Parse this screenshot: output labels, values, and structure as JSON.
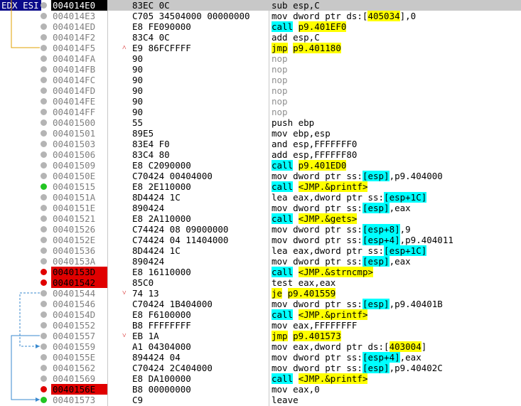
{
  "registers_label": "EDX ESI",
  "colors": {
    "breakpoint": "#e00000",
    "current": "#000000",
    "yellow": "#ffff00",
    "cyan": "#00ffff",
    "register_bg": "#0a0a8a"
  },
  "rows": [
    {
      "addr": "004014E0",
      "bytes": "83EC 0C",
      "parts": [
        [
          "sub esp,C",
          ""
        ]
      ],
      "kind": "current",
      "dot": "gray"
    },
    {
      "addr": "004014E3",
      "bytes": "C705 34504000 00000000",
      "parts": [
        [
          "mov dword ptr ds:[",
          ""
        ],
        [
          "405034",
          "y"
        ],
        [
          "],0",
          ""
        ]
      ],
      "kind": "",
      "dot": "gray"
    },
    {
      "addr": "004014ED",
      "bytes": "E8 FE090000",
      "parts": [
        [
          "call",
          "c"
        ],
        [
          " ",
          ""
        ],
        [
          "p9.401EF0",
          "y"
        ]
      ],
      "kind": "",
      "dot": "gray"
    },
    {
      "addr": "004014F2",
      "bytes": "83C4 0C",
      "parts": [
        [
          "add esp,C",
          ""
        ]
      ],
      "kind": "",
      "dot": "gray"
    },
    {
      "addr": "004014F5",
      "bytes": "E9 86FCFFFF",
      "parts": [
        [
          "jmp",
          "y"
        ],
        [
          " ",
          ""
        ],
        [
          "p9.401180",
          "y"
        ]
      ],
      "kind": "",
      "dot": "gray",
      "mark": "^"
    },
    {
      "addr": "004014FA",
      "bytes": "90",
      "parts": [
        [
          "nop",
          "n"
        ]
      ],
      "kind": "",
      "dot": "gray"
    },
    {
      "addr": "004014FB",
      "bytes": "90",
      "parts": [
        [
          "nop",
          "n"
        ]
      ],
      "kind": "",
      "dot": "gray"
    },
    {
      "addr": "004014FC",
      "bytes": "90",
      "parts": [
        [
          "nop",
          "n"
        ]
      ],
      "kind": "",
      "dot": "gray"
    },
    {
      "addr": "004014FD",
      "bytes": "90",
      "parts": [
        [
          "nop",
          "n"
        ]
      ],
      "kind": "",
      "dot": "gray"
    },
    {
      "addr": "004014FE",
      "bytes": "90",
      "parts": [
        [
          "nop",
          "n"
        ]
      ],
      "kind": "",
      "dot": "gray"
    },
    {
      "addr": "004014FF",
      "bytes": "90",
      "parts": [
        [
          "nop",
          "n"
        ]
      ],
      "kind": "",
      "dot": "gray"
    },
    {
      "addr": "00401500",
      "bytes": "55",
      "parts": [
        [
          "push ebp",
          ""
        ]
      ],
      "kind": "",
      "dot": "gray"
    },
    {
      "addr": "00401501",
      "bytes": "89E5",
      "parts": [
        [
          "mov ebp,esp",
          ""
        ]
      ],
      "kind": "",
      "dot": "gray"
    },
    {
      "addr": "00401503",
      "bytes": "83E4 F0",
      "parts": [
        [
          "and esp,FFFFFFF0",
          ""
        ]
      ],
      "kind": "",
      "dot": "gray"
    },
    {
      "addr": "00401506",
      "bytes": "83C4 80",
      "parts": [
        [
          "add esp,FFFFFF80",
          ""
        ]
      ],
      "kind": "",
      "dot": "gray"
    },
    {
      "addr": "00401509",
      "bytes": "E8 C2090000",
      "parts": [
        [
          "call",
          "c"
        ],
        [
          " ",
          ""
        ],
        [
          "p9.401ED0",
          "y"
        ]
      ],
      "kind": "",
      "dot": "gray"
    },
    {
      "addr": "0040150E",
      "bytes": "C70424 00404000",
      "parts": [
        [
          "mov dword ptr ss:",
          ""
        ],
        [
          "[esp]",
          "b"
        ],
        [
          ",p9.404000",
          ""
        ]
      ],
      "kind": "",
      "dot": "gray"
    },
    {
      "addr": "00401515",
      "bytes": "E8 2E110000",
      "parts": [
        [
          "call",
          "c"
        ],
        [
          " ",
          ""
        ],
        [
          "<JMP.&printf>",
          "y"
        ]
      ],
      "kind": "",
      "dot": "green"
    },
    {
      "addr": "0040151A",
      "bytes": "8D4424 1C",
      "parts": [
        [
          "lea eax,dword ptr ss:",
          ""
        ],
        [
          "[esp+1C]",
          "b"
        ]
      ],
      "kind": "",
      "dot": "gray"
    },
    {
      "addr": "0040151E",
      "bytes": "890424",
      "parts": [
        [
          "mov dword ptr ss:",
          ""
        ],
        [
          "[esp]",
          "b"
        ],
        [
          ",eax",
          ""
        ]
      ],
      "kind": "",
      "dot": "gray"
    },
    {
      "addr": "00401521",
      "bytes": "E8 2A110000",
      "parts": [
        [
          "call",
          "c"
        ],
        [
          " ",
          ""
        ],
        [
          "<JMP.&gets>",
          "y"
        ]
      ],
      "kind": "",
      "dot": "gray"
    },
    {
      "addr": "00401526",
      "bytes": "C74424 08 09000000",
      "parts": [
        [
          "mov dword ptr ss:",
          ""
        ],
        [
          "[esp+8]",
          "b"
        ],
        [
          ",9",
          ""
        ]
      ],
      "kind": "",
      "dot": "gray"
    },
    {
      "addr": "0040152E",
      "bytes": "C74424 04 11404000",
      "parts": [
        [
          "mov dword ptr ss:",
          ""
        ],
        [
          "[esp+4]",
          "b"
        ],
        [
          ",p9.404011",
          ""
        ]
      ],
      "kind": "",
      "dot": "gray"
    },
    {
      "addr": "00401536",
      "bytes": "8D4424 1C",
      "parts": [
        [
          "lea eax,dword ptr ss:",
          ""
        ],
        [
          "[esp+1C]",
          "b"
        ]
      ],
      "kind": "",
      "dot": "gray"
    },
    {
      "addr": "0040153A",
      "bytes": "890424",
      "parts": [
        [
          "mov dword ptr ss:",
          ""
        ],
        [
          "[esp]",
          "b"
        ],
        [
          ",eax",
          ""
        ]
      ],
      "kind": "",
      "dot": "gray"
    },
    {
      "addr": "0040153D",
      "bytes": "E8 16110000",
      "parts": [
        [
          "call",
          "c"
        ],
        [
          " ",
          ""
        ],
        [
          "<JMP.&strncmp>",
          "y"
        ]
      ],
      "kind": "bp",
      "dot": "red"
    },
    {
      "addr": "00401542",
      "bytes": "85C0",
      "parts": [
        [
          "test eax,eax",
          ""
        ]
      ],
      "kind": "bp",
      "dot": "red"
    },
    {
      "addr": "00401544",
      "bytes": "74 13",
      "parts": [
        [
          "je",
          "y"
        ],
        [
          " ",
          ""
        ],
        [
          "p9.401559",
          "y"
        ]
      ],
      "kind": "",
      "dot": "gray",
      "mark": "v"
    },
    {
      "addr": "00401546",
      "bytes": "C70424 1B404000",
      "parts": [
        [
          "mov dword ptr ss:",
          ""
        ],
        [
          "[esp]",
          "b"
        ],
        [
          ",p9.40401B",
          ""
        ]
      ],
      "kind": "",
      "dot": "gray"
    },
    {
      "addr": "0040154D",
      "bytes": "E8 F6100000",
      "parts": [
        [
          "call",
          "c"
        ],
        [
          " ",
          ""
        ],
        [
          "<JMP.&printf>",
          "y"
        ]
      ],
      "kind": "",
      "dot": "gray"
    },
    {
      "addr": "00401552",
      "bytes": "B8 FFFFFFFF",
      "parts": [
        [
          "mov eax,FFFFFFFF",
          ""
        ]
      ],
      "kind": "",
      "dot": "gray"
    },
    {
      "addr": "00401557",
      "bytes": "EB 1A",
      "parts": [
        [
          "jmp",
          "y"
        ],
        [
          " ",
          ""
        ],
        [
          "p9.401573",
          "y"
        ]
      ],
      "kind": "",
      "dot": "gray",
      "mark": "v"
    },
    {
      "addr": "00401559",
      "bytes": "A1 04304000",
      "parts": [
        [
          "mov eax,dword ptr ds:[",
          ""
        ],
        [
          "403004",
          "y"
        ],
        [
          "]",
          ""
        ]
      ],
      "kind": "",
      "dot": "gray"
    },
    {
      "addr": "0040155E",
      "bytes": "894424 04",
      "parts": [
        [
          "mov dword ptr ss:",
          ""
        ],
        [
          "[esp+4]",
          "b"
        ],
        [
          ",eax",
          ""
        ]
      ],
      "kind": "",
      "dot": "gray"
    },
    {
      "addr": "00401562",
      "bytes": "C70424 2C404000",
      "parts": [
        [
          "mov dword ptr ss:",
          ""
        ],
        [
          "[esp]",
          "b"
        ],
        [
          ",p9.40402C",
          ""
        ]
      ],
      "kind": "",
      "dot": "gray"
    },
    {
      "addr": "00401569",
      "bytes": "E8 DA100000",
      "parts": [
        [
          "call",
          "c"
        ],
        [
          " ",
          ""
        ],
        [
          "<JMP.&printf>",
          "y"
        ]
      ],
      "kind": "",
      "dot": "gray"
    },
    {
      "addr": "0040156E",
      "bytes": "B8 00000000",
      "parts": [
        [
          "mov eax,0",
          ""
        ]
      ],
      "kind": "bp",
      "dot": "red"
    },
    {
      "addr": "00401573",
      "bytes": "C9",
      "parts": [
        [
          "leave",
          ""
        ]
      ],
      "kind": "",
      "dot": "green"
    }
  ]
}
